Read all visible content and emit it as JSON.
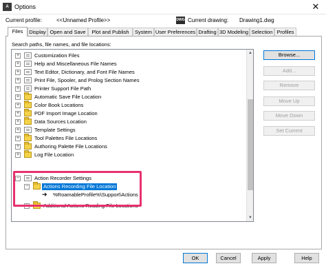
{
  "window": {
    "title": "Options",
    "app_icon_text": "A"
  },
  "profile": {
    "current_profile_label": "Current profile:",
    "current_profile_value": "<<Unnamed Profile>>",
    "current_drawing_label": "Current drawing:",
    "current_drawing_value": "Drawing1.dwg"
  },
  "tabs": [
    {
      "label": "Files",
      "active": true
    },
    {
      "label": "Display"
    },
    {
      "label": "Open and Save"
    },
    {
      "label": "Plot and Publish"
    },
    {
      "label": "System"
    },
    {
      "label": "User Preferences"
    },
    {
      "label": "Drafting"
    },
    {
      "label": "3D Modeling"
    },
    {
      "label": "Selection"
    },
    {
      "label": "Profiles"
    }
  ],
  "files_panel": {
    "caption": "Search paths, file names, and file locations:",
    "tree": [
      {
        "label": "Customization Files",
        "icon": "doc"
      },
      {
        "label": "Help and Miscellaneous File Names",
        "icon": "doc"
      },
      {
        "label": "Text Editor, Dictionary, and Font File Names",
        "icon": "doc"
      },
      {
        "label": "Print File, Spooler, and Prolog Section Names",
        "icon": "doc"
      },
      {
        "label": "Printer Support File Path",
        "icon": "doc"
      },
      {
        "label": "Automatic Save File Location",
        "icon": "folder"
      },
      {
        "label": "Color Book Locations",
        "icon": "folder"
      },
      {
        "label": "PDF Import Image Location",
        "icon": "folder"
      },
      {
        "label": "Data Sources Location",
        "icon": "folder"
      },
      {
        "label": "Template Settings",
        "icon": "doc"
      },
      {
        "label": "Tool Palettes File Locations",
        "icon": "folder"
      },
      {
        "label": "Authoring Palette File Locations",
        "icon": "folder"
      },
      {
        "label": "Log File Location",
        "icon": "folder"
      },
      {
        "label": "Action Recorder Settings",
        "icon": "doc"
      },
      {
        "label": "Actions Recording File Location",
        "icon": "folder",
        "selected": true
      },
      {
        "label": "%RoamableProfile%\\Support\\Actions",
        "icon": "arrow"
      },
      {
        "label": "Additional Actions Reading File Locations",
        "icon": "folder"
      }
    ],
    "buttons": {
      "browse": "Browse...",
      "add": "Add...",
      "remove": "Remove",
      "move_up": "Move Up",
      "move_down": "Move Down",
      "set_current": "Set Current"
    }
  },
  "footer": {
    "ok": "OK",
    "cancel": "Cancel",
    "apply": "Apply",
    "help": "Help"
  },
  "colors": {
    "selection": "#0078d7",
    "highlight_box": "#e8306e"
  },
  "icons": {
    "close": "close-icon",
    "expand": "plus-icon",
    "collapse": "minus-icon"
  }
}
